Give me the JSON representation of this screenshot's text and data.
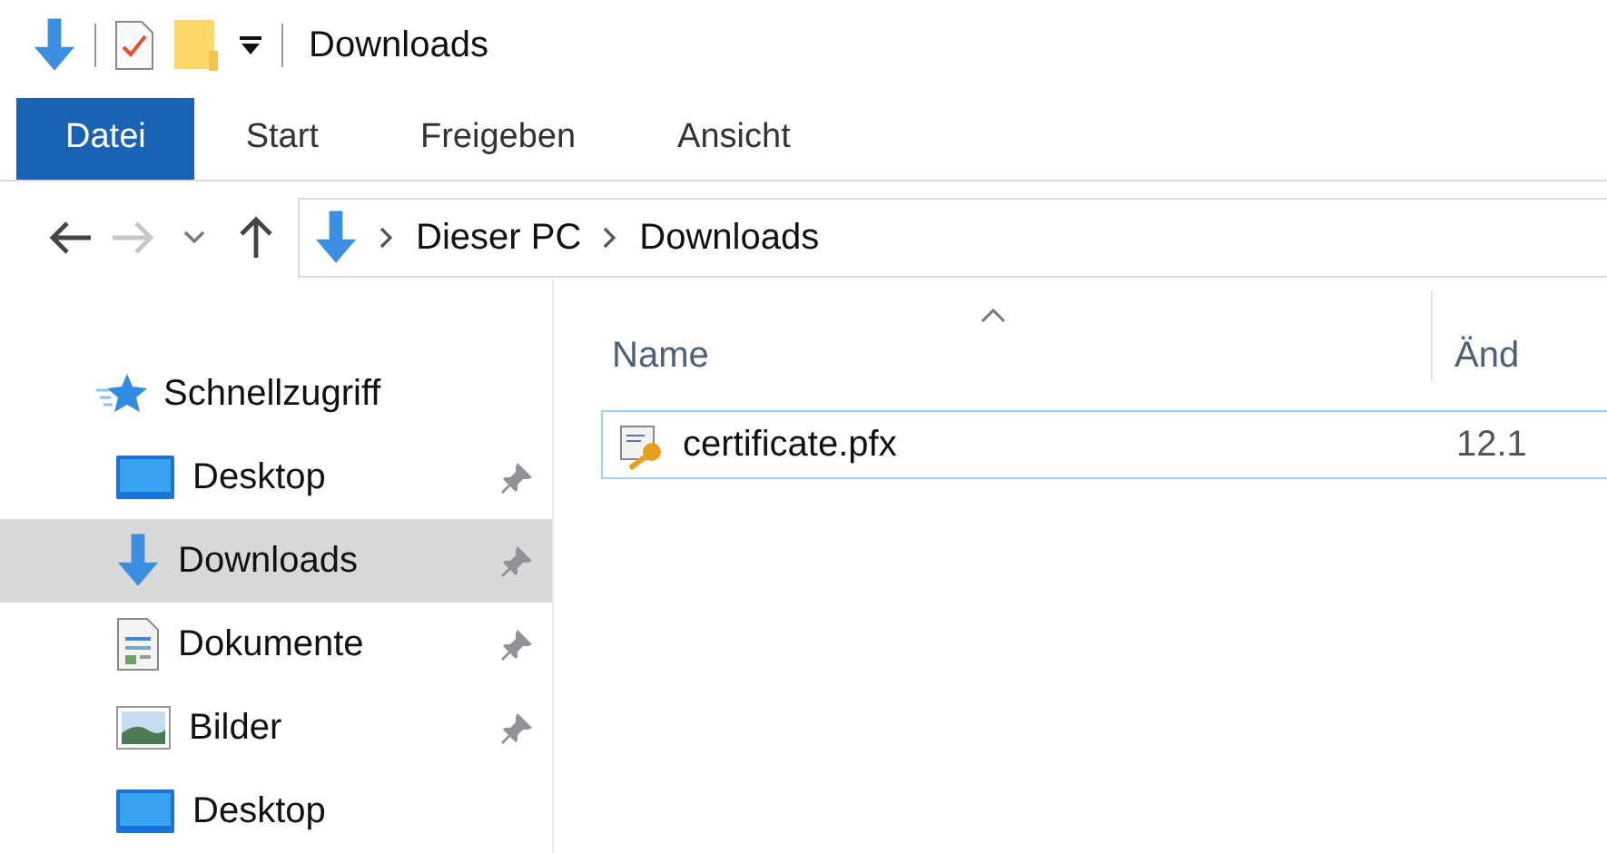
{
  "window": {
    "title": "Downloads"
  },
  "ribbon": {
    "tabs": [
      {
        "label": "Datei",
        "selected": true
      },
      {
        "label": "Start",
        "selected": false
      },
      {
        "label": "Freigeben",
        "selected": false
      },
      {
        "label": "Ansicht",
        "selected": false
      }
    ]
  },
  "navigation": {
    "back_disabled": false,
    "forward_disabled": true,
    "up_disabled": false
  },
  "address": {
    "segments": [
      "Dieser PC",
      "Downloads"
    ]
  },
  "sidebar": {
    "header": "Schnellzugriff",
    "items": [
      {
        "label": "Desktop",
        "kind": "desktop",
        "pinned": true,
        "selected": false
      },
      {
        "label": "Downloads",
        "kind": "downloads",
        "pinned": true,
        "selected": true
      },
      {
        "label": "Dokumente",
        "kind": "documents",
        "pinned": true,
        "selected": false
      },
      {
        "label": "Bilder",
        "kind": "pictures",
        "pinned": true,
        "selected": false
      },
      {
        "label": "Desktop",
        "kind": "desktop",
        "pinned": false,
        "selected": false
      }
    ]
  },
  "file_list": {
    "columns": [
      {
        "label": "Name",
        "sorted": true
      },
      {
        "label": "Änd",
        "sorted": false
      }
    ],
    "rows": [
      {
        "name": "certificate.pfx",
        "column_2": "12.1",
        "focused": true
      }
    ]
  }
}
